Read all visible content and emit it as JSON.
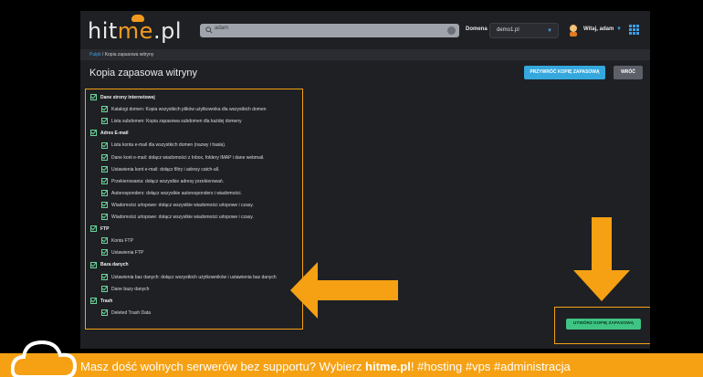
{
  "header": {
    "logo_part1": "hit",
    "logo_part2": "me",
    "logo_part3": ".pl",
    "search_value": "adam",
    "domain_label": "Domena",
    "domain_value": "demo1.pl",
    "user_label": "Witaj, adam"
  },
  "breadcrumb": {
    "home": "Pulpit",
    "separator": " / ",
    "current": "Kopia zapasowa witryny"
  },
  "page": {
    "title": "Kopia zapasowa witryny",
    "create_top_label": "PRZYWRÓĆ KOPIĘ ZAPASOWĄ",
    "back_label": "WRÓĆ",
    "create_label": "UTWÓRZ KOPIĘ ZAPASOWĄ"
  },
  "options": [
    {
      "label": "Dane strony internetowej",
      "group": true,
      "checked": true
    },
    {
      "label": "Katalogi domen: Kopia wszystkich plików użytkownika dla wszystkich domen",
      "group": false,
      "checked": true
    },
    {
      "label": "Lista subdomen: Kopia zapasowa subdomen dla każdej domeny",
      "group": false,
      "checked": true
    },
    {
      "label": "Adres E-mail",
      "group": true,
      "checked": true
    },
    {
      "label": "Lista konta e-mail dla wszystkich domen (nazwy i hasła).",
      "group": false,
      "checked": true
    },
    {
      "label": "Dane kont e-mail: dołącz wiadomości z Inbox, foldery IMAP i dane webmail.",
      "group": false,
      "checked": true
    },
    {
      "label": "Ustawienia kont e-mail: dołącz filtry i adresy catch-all.",
      "group": false,
      "checked": true
    },
    {
      "label": "Przekierowania: dołącz wszystkie adresy przekierowań.",
      "group": false,
      "checked": true
    },
    {
      "label": "Autoresponders: dołącz wszystkie autoresponders i wiadomości.",
      "group": false,
      "checked": true
    },
    {
      "label": "Wiadomości urlopowe: dołącz wszystkie wiadomości urlopowe i czasy.",
      "group": false,
      "checked": true
    },
    {
      "label": "Wiadomości urlopowe: dołącz wszystkie wiadomości urlopowe i czasy.",
      "group": false,
      "checked": true
    },
    {
      "label": "FTP",
      "group": true,
      "checked": true
    },
    {
      "label": "Konta FTP",
      "group": false,
      "checked": true
    },
    {
      "label": "Ustawienia FTP",
      "group": false,
      "checked": true
    },
    {
      "label": "Baza danych",
      "group": true,
      "checked": true
    },
    {
      "label": "Ustawienia baz danych: dołącz wszystkich użytkowników i ustawienia baz danych",
      "group": false,
      "checked": true
    },
    {
      "label": "Dane bazy danych",
      "group": false,
      "checked": true
    },
    {
      "label": "Trash",
      "group": true,
      "checked": true
    },
    {
      "label": "Deleted Trash Data",
      "group": false,
      "checked": true
    }
  ],
  "banner": {
    "text_before": "Masz dość wolnych serwerów bez supportu? Wybierz ",
    "brand": "hitme.pl",
    "text_after": "! #hosting #vps #administracja"
  },
  "colors": {
    "accent_orange": "#f5a113",
    "accent_blue": "#3ea0e8",
    "button_green": "#3fc483",
    "check_green": "#6ad59b"
  },
  "icons": [
    "search-icon",
    "clear-icon",
    "chevron-down-icon",
    "avatar-icon",
    "apps-grid-icon",
    "checkbox-icon",
    "arrow-left-icon",
    "arrow-down-icon",
    "cloud-logo-icon"
  ]
}
